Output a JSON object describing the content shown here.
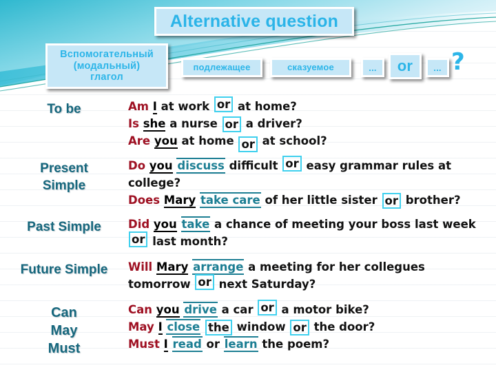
{
  "title": "Alternative question",
  "formula": {
    "aux_line1": "Вспомогательный",
    "aux_line2": "(модальный)",
    "aux_line3": "глагол",
    "subject": "подлежащее",
    "predicate": "сказуемое",
    "dots_left": "...",
    "or": "or",
    "dots_right": "...",
    "question_mark": "?"
  },
  "colors": {
    "chip_fill": "#c6e7f7",
    "chip_text": "#2cb5e8",
    "label_teal": "#16677d",
    "aux_red": "#9e1022",
    "predicate_teal": "#1c7e93",
    "or_box_border": "#3fd0ee",
    "body_text": "#111111"
  },
  "rows": [
    {
      "label_lines": [
        "To be"
      ],
      "sentences": [
        {
          "aux": "Am",
          "subject": "I",
          "mid": " at work ",
          "or": "or",
          "tail": " at home?"
        },
        {
          "aux": "Is",
          "subject": "she",
          "mid": " a nurse ",
          "or": "or",
          "tail": " a driver?"
        },
        {
          "aux": "Are",
          "subject": "you",
          "mid": " at home ",
          "or": "or",
          "tail": " at school?"
        }
      ]
    },
    {
      "label_lines": [
        "Present",
        "Simple"
      ],
      "sentences": [
        {
          "aux": "Do",
          "subject": "you",
          "predicate": "discuss",
          "mid": " difficult ",
          "or": "or",
          "tail": " easy grammar rules at college?"
        },
        {
          "aux": "Does",
          "subject": "Mary",
          "predicate": "take care",
          "mid": " of her little sister ",
          "or": "or",
          "tail": " brother?"
        }
      ]
    },
    {
      "label_lines": [
        "Past Simple"
      ],
      "sentences": [
        {
          "aux": "Did",
          "subject": "you",
          "predicate": "take",
          "mid": " a chance of meeting your boss last week ",
          "or": "or",
          "tail": " last month?"
        }
      ]
    },
    {
      "label_lines": [
        "Future Simple"
      ],
      "sentences": [
        {
          "aux": "Will",
          "subject": "Mary",
          "predicate": "arrange",
          "mid": " a meeting for her collegues tomorrow ",
          "or": "or",
          "tail": " next Saturday?"
        }
      ]
    },
    {
      "label_lines": [
        "Can",
        "May",
        "Must"
      ],
      "sentences": [
        {
          "aux": "Can",
          "subject": "you",
          "predicate": "drive",
          "mid": " a car ",
          "or": "or",
          "tail": " a motor bike?"
        },
        {
          "aux": "May",
          "subject": "I",
          "predicate": "close",
          "mid": " ",
          "or": "the",
          "tail": " window ",
          "or2": "or",
          "tail2": " the door?"
        },
        {
          "aux": "Must",
          "subject": "I",
          "predicate": "read",
          "mid": " or ",
          "predicate2": "learn",
          "tail": " the poem?"
        }
      ]
    }
  ]
}
